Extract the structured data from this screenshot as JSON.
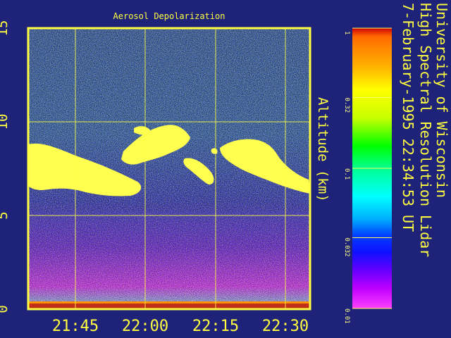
{
  "chart_data": {
    "type": "heatmap",
    "title": "Aerosol Depolarization",
    "ylabel": "Altitude (km)",
    "x_ticks": [
      "21:45",
      "22:00",
      "22:15",
      "22:30"
    ],
    "y_ticks": [
      "0",
      "5",
      "10",
      "15"
    ],
    "ylim": [
      0,
      15
    ],
    "colorbar": {
      "ticks": [
        "1",
        "0.32",
        "0.1",
        "0.032",
        "0.01"
      ],
      "scale": "log",
      "range": [
        0.01,
        1
      ]
    },
    "side_text": [
      "University of Wisconsin",
      "High Spectral Resolution Lidar",
      "7-February-1995 22:34:53 UT"
    ],
    "grid": true,
    "colors": {
      "background": "#1e2379",
      "frame": "#ffff40",
      "aerosol_layer": "#ffff50",
      "boundary_layer": "#d040f0"
    }
  }
}
